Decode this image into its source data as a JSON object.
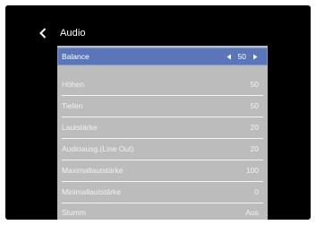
{
  "header": {
    "back_icon": "chevron-left-icon",
    "title": "Audio"
  },
  "menu": {
    "items": [
      {
        "label": "Balance",
        "value": "50",
        "selected": true
      },
      {
        "label": "Höhen",
        "value": "50"
      },
      {
        "label": "Tiefen",
        "value": "50"
      },
      {
        "label": "Lautstärke",
        "value": "20"
      },
      {
        "label": "Audioausg.(Line Out)",
        "value": "20"
      },
      {
        "label": "Maximallautstärke",
        "value": "100"
      },
      {
        "label": "Minimallautstärke",
        "value": "0"
      },
      {
        "label": "Stumm",
        "value": "Aus"
      }
    ]
  },
  "colors": {
    "background": "#000000",
    "panel": "#bcbcbc",
    "selected": "#5a76b8",
    "text": "#ffffff"
  }
}
